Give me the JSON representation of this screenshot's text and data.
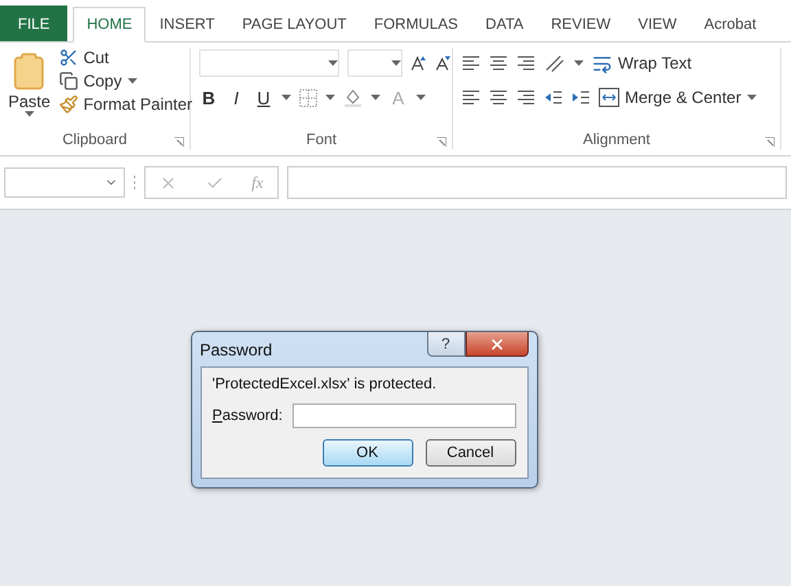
{
  "tabs": [
    {
      "label": "FILE",
      "kind": "file",
      "selected": false
    },
    {
      "label": "HOME",
      "kind": "tab",
      "selected": true
    },
    {
      "label": "INSERT",
      "kind": "tab",
      "selected": false
    },
    {
      "label": "PAGE LAYOUT",
      "kind": "tab",
      "selected": false
    },
    {
      "label": "FORMULAS",
      "kind": "tab",
      "selected": false
    },
    {
      "label": "DATA",
      "kind": "tab",
      "selected": false
    },
    {
      "label": "REVIEW",
      "kind": "tab",
      "selected": false
    },
    {
      "label": "VIEW",
      "kind": "tab",
      "selected": false
    },
    {
      "label": "Acrobat",
      "kind": "tab",
      "selected": false
    }
  ],
  "clipboard": {
    "label": "Clipboard",
    "paste": "Paste",
    "cut": "Cut",
    "copy": "Copy",
    "format_painter": "Format Painter"
  },
  "font": {
    "label": "Font",
    "bold": "B",
    "italic": "I",
    "underline": "U",
    "font_color": "A"
  },
  "alignment": {
    "label": "Alignment",
    "wrap_text": "Wrap Text",
    "merge_center": "Merge & Center"
  },
  "formula_bar": {
    "function_label": "fx"
  },
  "dialog": {
    "title": "Password",
    "help": "?",
    "message": "'ProtectedExcel.xlsx' is protected.",
    "field_label": "Password:",
    "buttons": [
      {
        "label": "OK",
        "selected": true
      },
      {
        "label": "Cancel",
        "selected": false
      }
    ]
  }
}
